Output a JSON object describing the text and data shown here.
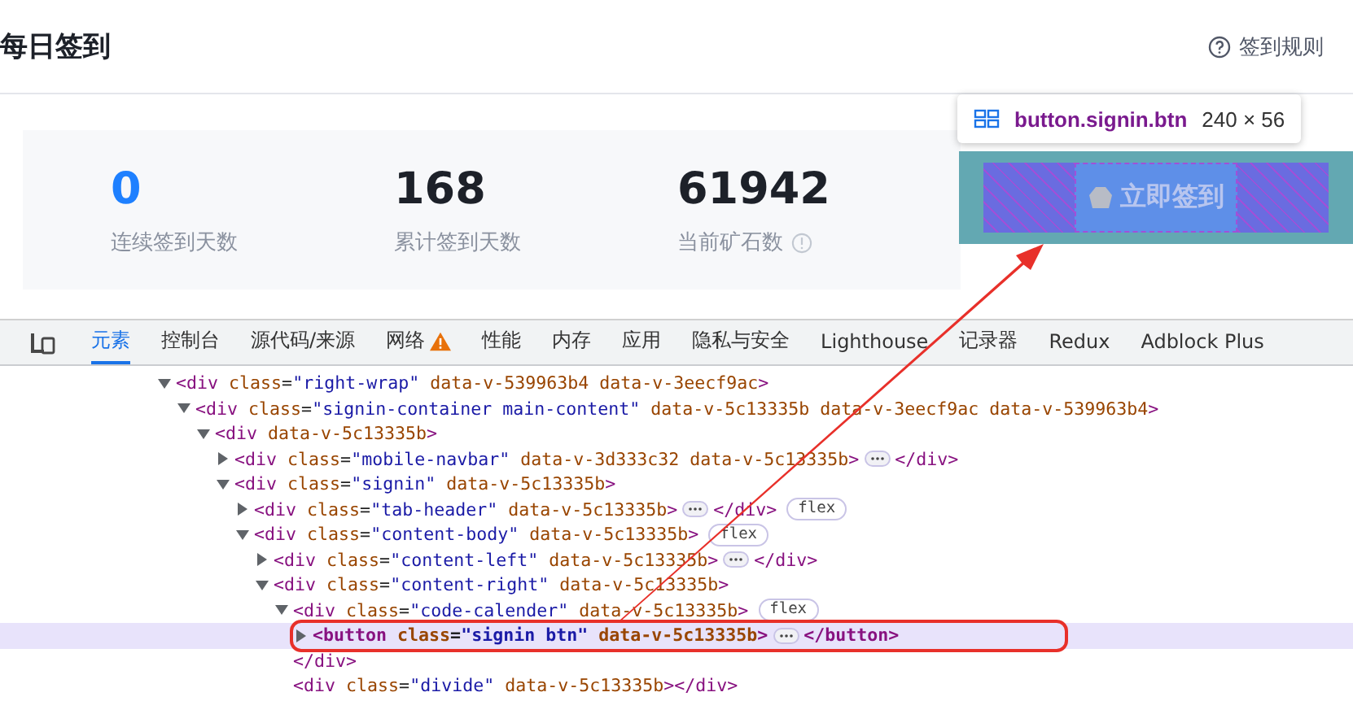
{
  "page": {
    "title": "每日签到",
    "rules_link": "签到规则",
    "stats": [
      {
        "value": "0",
        "label": "连续签到天数",
        "accent": true,
        "info": false
      },
      {
        "value": "168",
        "label": "累计签到天数",
        "accent": false,
        "info": false
      },
      {
        "value": "61942",
        "label": "当前矿石数",
        "accent": false,
        "info": true
      }
    ],
    "signin_button": "立即签到",
    "inspect_tooltip": {
      "selector": "button.signin.btn",
      "size": "240 × 56"
    }
  },
  "devtools": {
    "tabs": [
      {
        "label": "元素",
        "selected": true,
        "warning": false
      },
      {
        "label": "控制台",
        "selected": false,
        "warning": false
      },
      {
        "label": "源代码/来源",
        "selected": false,
        "warning": false
      },
      {
        "label": "网络",
        "selected": false,
        "warning": true
      },
      {
        "label": "性能",
        "selected": false,
        "warning": false
      },
      {
        "label": "内存",
        "selected": false,
        "warning": false
      },
      {
        "label": "应用",
        "selected": false,
        "warning": false
      },
      {
        "label": "隐私与安全",
        "selected": false,
        "warning": false
      },
      {
        "label": "Lighthouse",
        "selected": false,
        "warning": false
      },
      {
        "label": "记录器",
        "selected": false,
        "warning": false
      },
      {
        "label": "Redux",
        "selected": false,
        "warning": false
      },
      {
        "label": "Adblock Plus",
        "selected": false,
        "warning": false
      }
    ],
    "tree": [
      {
        "open": "<div class=\"right-wrap\" data-v-539963b4 data-v-3eecf9ac>",
        "expanded": true,
        "selected": false,
        "children": [
          {
            "open": "<div class=\"signin-container main-content\" data-v-5c13335b data-v-3eecf9ac data-v-539963b4>",
            "expanded": true,
            "selected": false,
            "children": [
              {
                "open": "<div data-v-5c13335b>",
                "expanded": true,
                "selected": false,
                "children": [
                  {
                    "open": "<div class=\"mobile-navbar\" data-v-3d333c32 data-v-5c13335b>",
                    "expanded": false,
                    "selected": false,
                    "close": "</div>"
                  },
                  {
                    "open": "<div class=\"signin\" data-v-5c13335b>",
                    "expanded": true,
                    "selected": false,
                    "children": [
                      {
                        "open": "<div class=\"tab-header\" data-v-5c13335b>",
                        "expanded": false,
                        "selected": false,
                        "close": "</div>",
                        "badge": "flex"
                      },
                      {
                        "open": "<div class=\"content-body\" data-v-5c13335b>",
                        "expanded": true,
                        "selected": false,
                        "badge": "flex",
                        "children": [
                          {
                            "open": "<div class=\"content-left\" data-v-5c13335b>",
                            "expanded": false,
                            "selected": false,
                            "close": "</div>"
                          },
                          {
                            "open": "<div class=\"content-right\" data-v-5c13335b>",
                            "expanded": true,
                            "selected": false,
                            "children": [
                              {
                                "open": "<div class=\"code-calender\" data-v-5c13335b>",
                                "expanded": true,
                                "selected": false,
                                "badge": "flex",
                                "close": "</div>",
                                "children": [
                                  {
                                    "open": "<button class=\"signin btn\" data-v-5c13335b>",
                                    "expanded": false,
                                    "selected": true,
                                    "close": "</button>"
                                  }
                                ]
                              },
                              {
                                "open": "<div class=\"divide\" data-v-5c13335b></div>",
                                "selected": false
                              }
                            ]
                          }
                        ]
                      }
                    ]
                  }
                ]
              }
            ]
          }
        ]
      }
    ]
  }
}
